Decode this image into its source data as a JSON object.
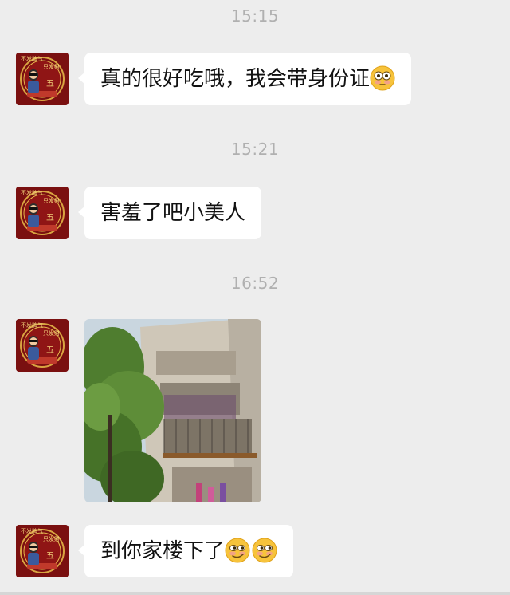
{
  "messages": [
    {
      "timestamp": "15:15",
      "text": "真的很好吃哦，我会带身份证",
      "emojis": [
        "flushed-face-emoji"
      ]
    },
    {
      "timestamp": "15:21",
      "text": "害羞了吧小美人",
      "emojis": []
    },
    {
      "timestamp": "16:52",
      "type": "image",
      "image_desc": "apartment-building-photo"
    },
    {
      "text": "到你家楼下了",
      "emojis": [
        "smirking-face-emoji",
        "smirking-face-emoji"
      ]
    }
  ],
  "colors": {
    "background": "#ededed",
    "bubble": "#ffffff",
    "timestamp_text": "#b0b0b0",
    "avatar_bg": "#7a1010"
  }
}
